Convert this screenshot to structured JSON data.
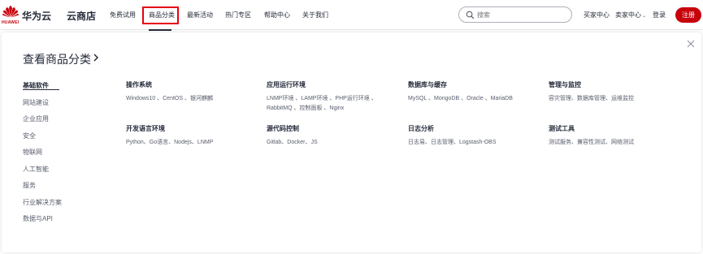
{
  "header": {
    "logo_text": "HUAWEI",
    "brand": "华为云",
    "store": "云商店",
    "nav": [
      "免费试用",
      "商品分类",
      "最新活动",
      "热门专区",
      "帮助中心",
      "关于我们"
    ],
    "search_placeholder": "搜索",
    "buyer_center": "买家中心",
    "seller_center": "卖家中心",
    "login": "登录",
    "register": "注册",
    "brand_color": "#c7000b"
  },
  "panel": {
    "heading": "查看商品分类",
    "sidebar": [
      "基础软件",
      "网站建设",
      "企业应用",
      "安全",
      "物联网",
      "人工智能",
      "服务",
      "行业解决方案",
      "数据与API"
    ],
    "categories": [
      {
        "title": "操作系统",
        "items": "Windows10 、CentOS 、银河麒麟"
      },
      {
        "title": "应用运行环境",
        "items": "LNMP环境 、LAMP环境 、PHP运行环境 、RabbitMQ 、控制面板 、Nginx"
      },
      {
        "title": "数据库与缓存",
        "items": "MySQL 、MongoDB 、Oracle 、MariaDB"
      },
      {
        "title": "管理与监控",
        "items": "容灾管理、数据库管理、运维监控"
      },
      {
        "title": "开发语言环境",
        "items": "Python、Go语言、Nodejs、LNMP"
      },
      {
        "title": "源代码控制",
        "items": "Gitlab、Docker、JS"
      },
      {
        "title": "日志分析",
        "items": "日志易、日志管理、Logstash-OBS"
      },
      {
        "title": "测试工具",
        "items": "测试服务、兼容性测试、网络测试"
      }
    ]
  }
}
